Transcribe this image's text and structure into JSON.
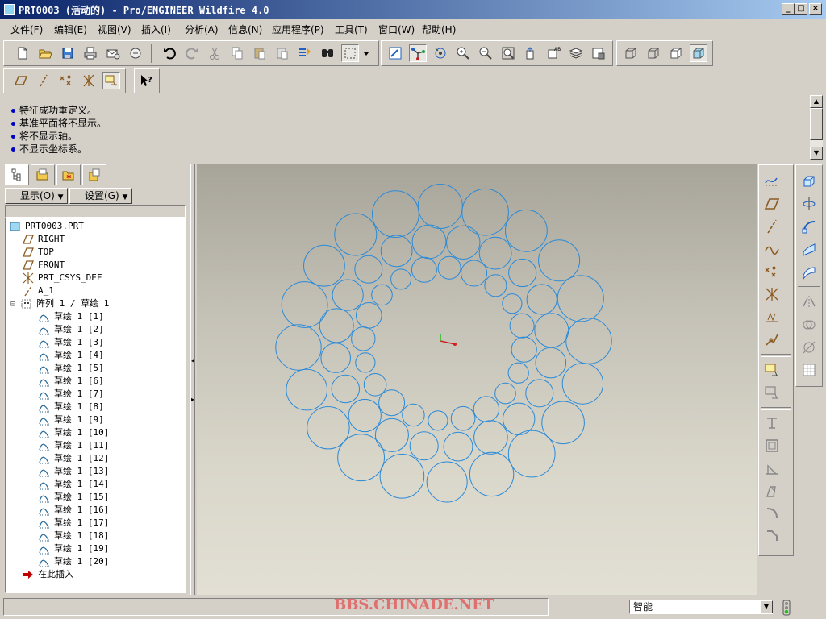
{
  "window": {
    "title": "PRT0003 (活动的) - Pro/ENGINEER Wildfire 4.0",
    "min_label": "_",
    "max_label": "□",
    "close_label": "×"
  },
  "menu": [
    {
      "label": "文件(F)"
    },
    {
      "label": "编辑(E)"
    },
    {
      "label": "视图(V)"
    },
    {
      "label": "插入(I)"
    },
    {
      "label": "分析(A)"
    },
    {
      "label": "信息(N)"
    },
    {
      "label": "应用程序(P)"
    },
    {
      "label": "工具(T)"
    },
    {
      "label": "窗口(W)"
    },
    {
      "label": "帮助(H)"
    }
  ],
  "toolbar_icons": [
    "new-file-icon",
    "open-folder-icon",
    "save-icon",
    "print-icon",
    "send-mail-icon",
    "erase-icon",
    "undo-icon",
    "redo-icon",
    "cut-icon",
    "copy-icon",
    "paste-icon",
    "paste-special-icon",
    "regenerate-icon",
    "find-icon",
    "select-box-icon",
    "dropdown-arrow-icon",
    "repaint-icon",
    "spin-center-icon",
    "orient-mode-icon",
    "zoom-in-icon",
    "zoom-out-icon",
    "refit-icon",
    "reorient-icon",
    "saved-views-icon",
    "layers-icon",
    "view-manager-icon",
    "wireframe-icon",
    "hidden-line-icon",
    "no-hidden-icon",
    "shading-icon"
  ],
  "toolbar2_icons": [
    "datum-plane-display-icon",
    "datum-axis-display-icon",
    "datum-point-display-icon",
    "csys-display-icon",
    "annotation-display-icon",
    "context-help-icon"
  ],
  "messages": [
    "特征成功重定义。",
    "基准平面将不显示。",
    "将不显示轴。",
    "不显示坐标系。"
  ],
  "left_panel": {
    "show_button": "显示(O)",
    "settings_button": "设置(G)",
    "tabs": [
      "model-tree-tab-icon",
      "folder-browser-tab-icon",
      "favorites-tab-icon",
      "connections-tab-icon"
    ]
  },
  "model_tree": {
    "root": "PRT0003.PRT",
    "items": [
      {
        "label": "RIGHT",
        "icon": "datum-plane-icon"
      },
      {
        "label": "TOP",
        "icon": "datum-plane-icon"
      },
      {
        "label": "FRONT",
        "icon": "datum-plane-icon"
      },
      {
        "label": "PRT_CSYS_DEF",
        "icon": "csys-icon"
      },
      {
        "label": "A_1",
        "icon": "axis-icon"
      },
      {
        "label": "阵列 1 / 草绘 1",
        "icon": "pattern-icon",
        "expanded": true
      }
    ],
    "pattern_children": [
      "草绘 1 [1]",
      "草绘 1 [2]",
      "草绘 1 [3]",
      "草绘 1 [4]",
      "草绘 1 [5]",
      "草绘 1 [6]",
      "草绘 1 [7]",
      "草绘 1 [8]",
      "草绘 1 [9]",
      "草绘 1 [10]",
      "草绘 1 [11]",
      "草绘 1 [12]",
      "草绘 1 [13]",
      "草绘 1 [14]",
      "草绘 1 [15]",
      "草绘 1 [16]",
      "草绘 1 [17]",
      "草绘 1 [18]",
      "草绘 1 [19]",
      "草绘 1 [20]"
    ],
    "insert_here": "在此插入"
  },
  "graphics": {
    "curve_color": "#2a8ad8",
    "ring_count": 20,
    "rings": [
      {
        "circle_count": 20,
        "ring_radius": 100,
        "circle_radius": 14
      },
      {
        "circle_count": 20,
        "ring_radius": 135,
        "circle_radius": 19
      },
      {
        "circle_count": 20,
        "ring_radius": 180,
        "circle_radius": 27
      }
    ]
  },
  "right_toolbar_left_icons": [
    "sketch-datum-curve-icon",
    "datum-plane-tool-icon",
    "datum-axis-tool-icon",
    "datum-curve-tool-icon",
    "datum-point-tool-icon",
    "csys-tool-icon",
    "analysis-feature-icon",
    "insert-datum-icon",
    "sketch-tool-icon",
    "edit-sketch-icon",
    "hole-tool-icon",
    "shell-tool-icon",
    "rib-tool-icon",
    "draft-tool-icon",
    "round-tool-icon",
    "chamfer-tool-icon"
  ],
  "right_toolbar_right_icons": [
    "extrude-tool-icon",
    "revolve-tool-icon",
    "variable-sweep-icon",
    "boundary-blend-icon",
    "style-tool-icon",
    "mirror-tool-icon",
    "merge-tool-icon",
    "trim-tool-icon",
    "pattern-tool-icon"
  ],
  "status": {
    "watermark": "BBS.CHINADE.NET",
    "filter_value": "智能"
  }
}
